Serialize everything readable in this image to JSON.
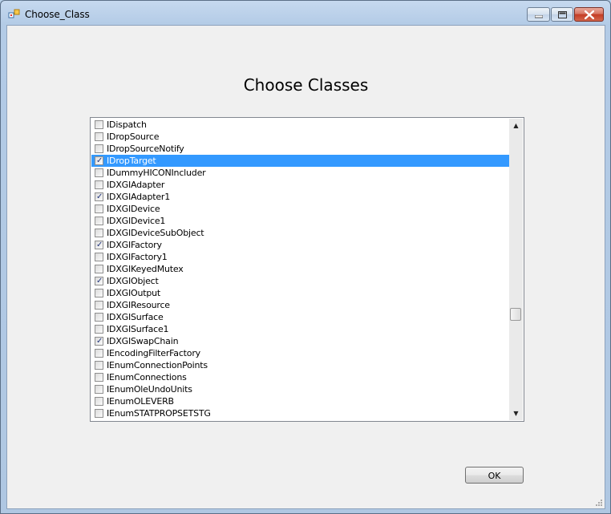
{
  "window": {
    "title": "Choose_Class"
  },
  "dialog": {
    "heading": "Choose Classes",
    "ok_label": "OK"
  },
  "list": {
    "items": [
      {
        "label": "IDispatch",
        "checked": false,
        "selected": false
      },
      {
        "label": "IDropSource",
        "checked": false,
        "selected": false
      },
      {
        "label": "IDropSourceNotify",
        "checked": false,
        "selected": false
      },
      {
        "label": "IDropTarget",
        "checked": true,
        "selected": true
      },
      {
        "label": "IDummyHICONIncluder",
        "checked": false,
        "selected": false
      },
      {
        "label": "IDXGIAdapter",
        "checked": false,
        "selected": false
      },
      {
        "label": "IDXGIAdapter1",
        "checked": true,
        "selected": false
      },
      {
        "label": "IDXGIDevice",
        "checked": false,
        "selected": false
      },
      {
        "label": "IDXGIDevice1",
        "checked": false,
        "selected": false
      },
      {
        "label": "IDXGIDeviceSubObject",
        "checked": false,
        "selected": false
      },
      {
        "label": "IDXGIFactory",
        "checked": true,
        "selected": false
      },
      {
        "label": "IDXGIFactory1",
        "checked": false,
        "selected": false
      },
      {
        "label": "IDXGIKeyedMutex",
        "checked": false,
        "selected": false
      },
      {
        "label": "IDXGIObject",
        "checked": true,
        "selected": false
      },
      {
        "label": "IDXGIOutput",
        "checked": false,
        "selected": false
      },
      {
        "label": "IDXGIResource",
        "checked": false,
        "selected": false
      },
      {
        "label": "IDXGISurface",
        "checked": false,
        "selected": false
      },
      {
        "label": "IDXGISurface1",
        "checked": false,
        "selected": false
      },
      {
        "label": "IDXGISwapChain",
        "checked": true,
        "selected": false
      },
      {
        "label": "IEncodingFilterFactory",
        "checked": false,
        "selected": false
      },
      {
        "label": "IEnumConnectionPoints",
        "checked": false,
        "selected": false
      },
      {
        "label": "IEnumConnections",
        "checked": false,
        "selected": false
      },
      {
        "label": "IEnumOleUndoUnits",
        "checked": false,
        "selected": false
      },
      {
        "label": "IEnumOLEVERB",
        "checked": false,
        "selected": false
      },
      {
        "label": "IEnumSTATPROPSETSTG",
        "checked": false,
        "selected": false
      }
    ]
  },
  "scrollbar": {
    "up_glyph": "▲",
    "down_glyph": "▼"
  },
  "colors": {
    "selection": "#3399ff",
    "client_bg": "#f0f0f0"
  },
  "icons": [
    "app-icon",
    "minimize-icon",
    "maximize-icon",
    "close-icon",
    "check-icon",
    "size-grip-icon"
  ]
}
